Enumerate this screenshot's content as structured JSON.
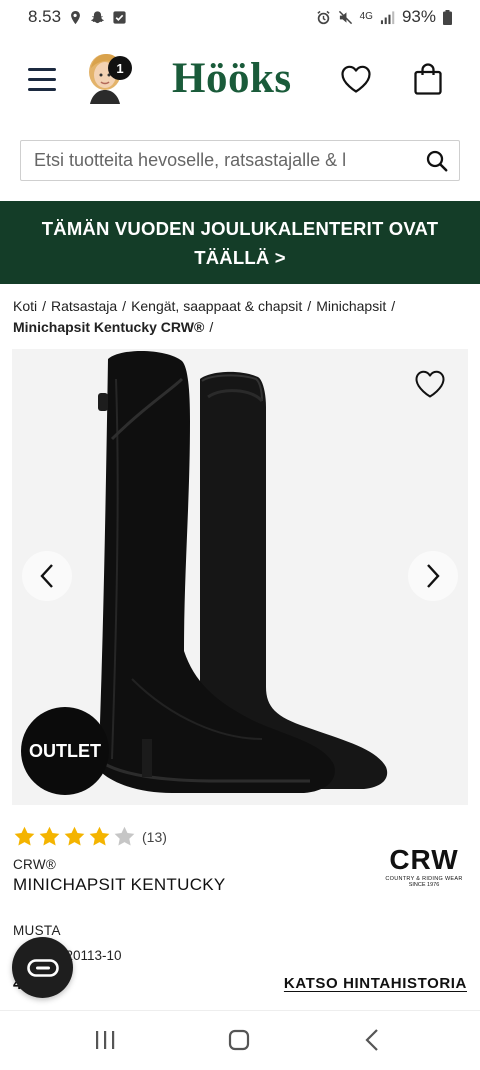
{
  "status_bar": {
    "time": "8.53",
    "network": "4G",
    "battery": "93%"
  },
  "header": {
    "logo": "Hööks",
    "cart_badge_count": "1"
  },
  "search": {
    "placeholder": "Etsi tuotteita hevoselle, ratsastajalle & l"
  },
  "banner": {
    "text": "TÄMÄN VUODEN JOULUKALENTERIT OVAT TÄÄLLÄ >"
  },
  "breadcrumb": {
    "items": [
      "Koti",
      "Ratsastaja",
      "Kengät, saappaat & chapsit",
      "Minichapsit"
    ],
    "current": "Minichapsit Kentucky CRW®",
    "separator": "/"
  },
  "product": {
    "outlet_badge": "OUTLET",
    "rating_stars": 4,
    "rating_max": 5,
    "review_count": "(13)",
    "brand": "CRW®",
    "name": "MINICHAPSIT KENTUCKY",
    "color": "MUSTA",
    "sku": "20113-10",
    "price_peek": "4",
    "price_history_link": "KATSO HINTAHISTORIA",
    "brand_logo": {
      "main": "CRW",
      "line1": "COUNTRY & RIDING WEAR",
      "line2": "SINCE 1976"
    }
  },
  "colors": {
    "brand_green": "#1a5b3a",
    "banner_bg": "#143d28",
    "star_filled": "#f4b400",
    "star_empty": "#c6c6c6"
  }
}
